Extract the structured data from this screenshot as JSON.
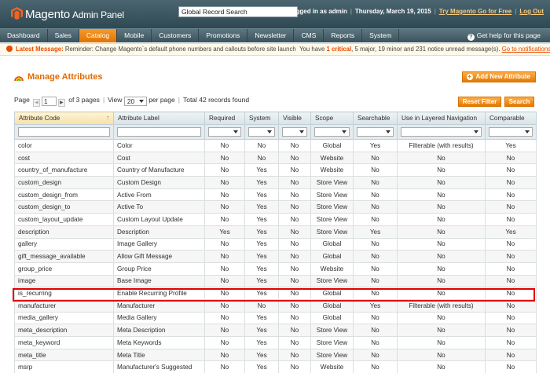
{
  "header": {
    "logo_word": "Magento",
    "logo_sub": "Admin Panel",
    "search_value": "Global Record Search",
    "logged_in": "Logged in as admin",
    "date": "Thursday, March 19, 2015",
    "try_link": "Try Magento Go for Free",
    "logout": "Log Out"
  },
  "nav": {
    "items": [
      {
        "label": "Dashboard"
      },
      {
        "label": "Sales"
      },
      {
        "label": "Catalog"
      },
      {
        "label": "Mobile"
      },
      {
        "label": "Customers"
      },
      {
        "label": "Promotions"
      },
      {
        "label": "Newsletter"
      },
      {
        "label": "CMS"
      },
      {
        "label": "Reports"
      },
      {
        "label": "System"
      }
    ],
    "active": "Catalog",
    "help": "Get help for this page"
  },
  "notice": {
    "label": "Latest Message:",
    "text": "Reminder: Change Magento`s default phone numbers and callouts before site launch",
    "you_have": "You have",
    "critical": "1 critical",
    "rest": ", 5 major, 19 minor and 231 notice unread message(s).",
    "link": "Go to notifications"
  },
  "page": {
    "title": "Manage Attributes",
    "add_button": "Add New Attribute"
  },
  "pager": {
    "page_label": "Page",
    "page_value": "1",
    "of_pages": "of 3 pages",
    "view_label": "View",
    "view_value": "20",
    "per_page": "per page",
    "total": "Total 42 records found",
    "reset": "Reset Filter",
    "search": "Search"
  },
  "grid": {
    "columns": [
      "Attribute Code",
      "Attribute Label",
      "Required",
      "System",
      "Visible",
      "Scope",
      "Searchable",
      "Use in Layered Navigation",
      "Comparable"
    ],
    "sort_indicator": "↑",
    "rows": [
      [
        "color",
        "Color",
        "No",
        "No",
        "No",
        "Global",
        "Yes",
        "Filterable (with results)",
        "Yes"
      ],
      [
        "cost",
        "Cost",
        "No",
        "No",
        "No",
        "Website",
        "No",
        "No",
        "No"
      ],
      [
        "country_of_manufacture",
        "Country of Manufacture",
        "No",
        "Yes",
        "No",
        "Website",
        "No",
        "No",
        "No"
      ],
      [
        "custom_design",
        "Custom Design",
        "No",
        "Yes",
        "No",
        "Store View",
        "No",
        "No",
        "No"
      ],
      [
        "custom_design_from",
        "Active From",
        "No",
        "Yes",
        "No",
        "Store View",
        "No",
        "No",
        "No"
      ],
      [
        "custom_design_to",
        "Active To",
        "No",
        "Yes",
        "No",
        "Store View",
        "No",
        "No",
        "No"
      ],
      [
        "custom_layout_update",
        "Custom Layout Update",
        "No",
        "Yes",
        "No",
        "Store View",
        "No",
        "No",
        "No"
      ],
      [
        "description",
        "Description",
        "Yes",
        "Yes",
        "No",
        "Store View",
        "Yes",
        "No",
        "Yes"
      ],
      [
        "gallery",
        "Image Gallery",
        "No",
        "Yes",
        "No",
        "Global",
        "No",
        "No",
        "No"
      ],
      [
        "gift_message_available",
        "Allow Gift Message",
        "No",
        "Yes",
        "No",
        "Global",
        "No",
        "No",
        "No"
      ],
      [
        "group_price",
        "Group Price",
        "No",
        "Yes",
        "No",
        "Website",
        "No",
        "No",
        "No"
      ],
      [
        "image",
        "Base Image",
        "No",
        "Yes",
        "No",
        "Store View",
        "No",
        "No",
        "No"
      ],
      [
        "is_recurring",
        "Enable Recurring Profile",
        "No",
        "Yes",
        "No",
        "Global",
        "No",
        "No",
        "No"
      ],
      [
        "manufacturer",
        "Manufacturer",
        "No",
        "No",
        "No",
        "Global",
        "Yes",
        "Filterable (with results)",
        "No"
      ],
      [
        "media_gallery",
        "Media Gallery",
        "No",
        "Yes",
        "No",
        "Global",
        "No",
        "No",
        "No"
      ],
      [
        "meta_description",
        "Meta Description",
        "No",
        "Yes",
        "No",
        "Store View",
        "No",
        "No",
        "No"
      ],
      [
        "meta_keyword",
        "Meta Keywords",
        "No",
        "Yes",
        "No",
        "Store View",
        "No",
        "No",
        "No"
      ],
      [
        "meta_title",
        "Meta Title",
        "No",
        "Yes",
        "No",
        "Store View",
        "No",
        "No",
        "No"
      ],
      [
        "msrp",
        "Manufacturer's Suggested",
        "No",
        "Yes",
        "No",
        "Website",
        "No",
        "No",
        "No"
      ]
    ],
    "highlighted_row": "is_recurring"
  },
  "colors": {
    "accent": "#e26a00",
    "header": "#3d5a66",
    "highlight": "#e00000"
  }
}
